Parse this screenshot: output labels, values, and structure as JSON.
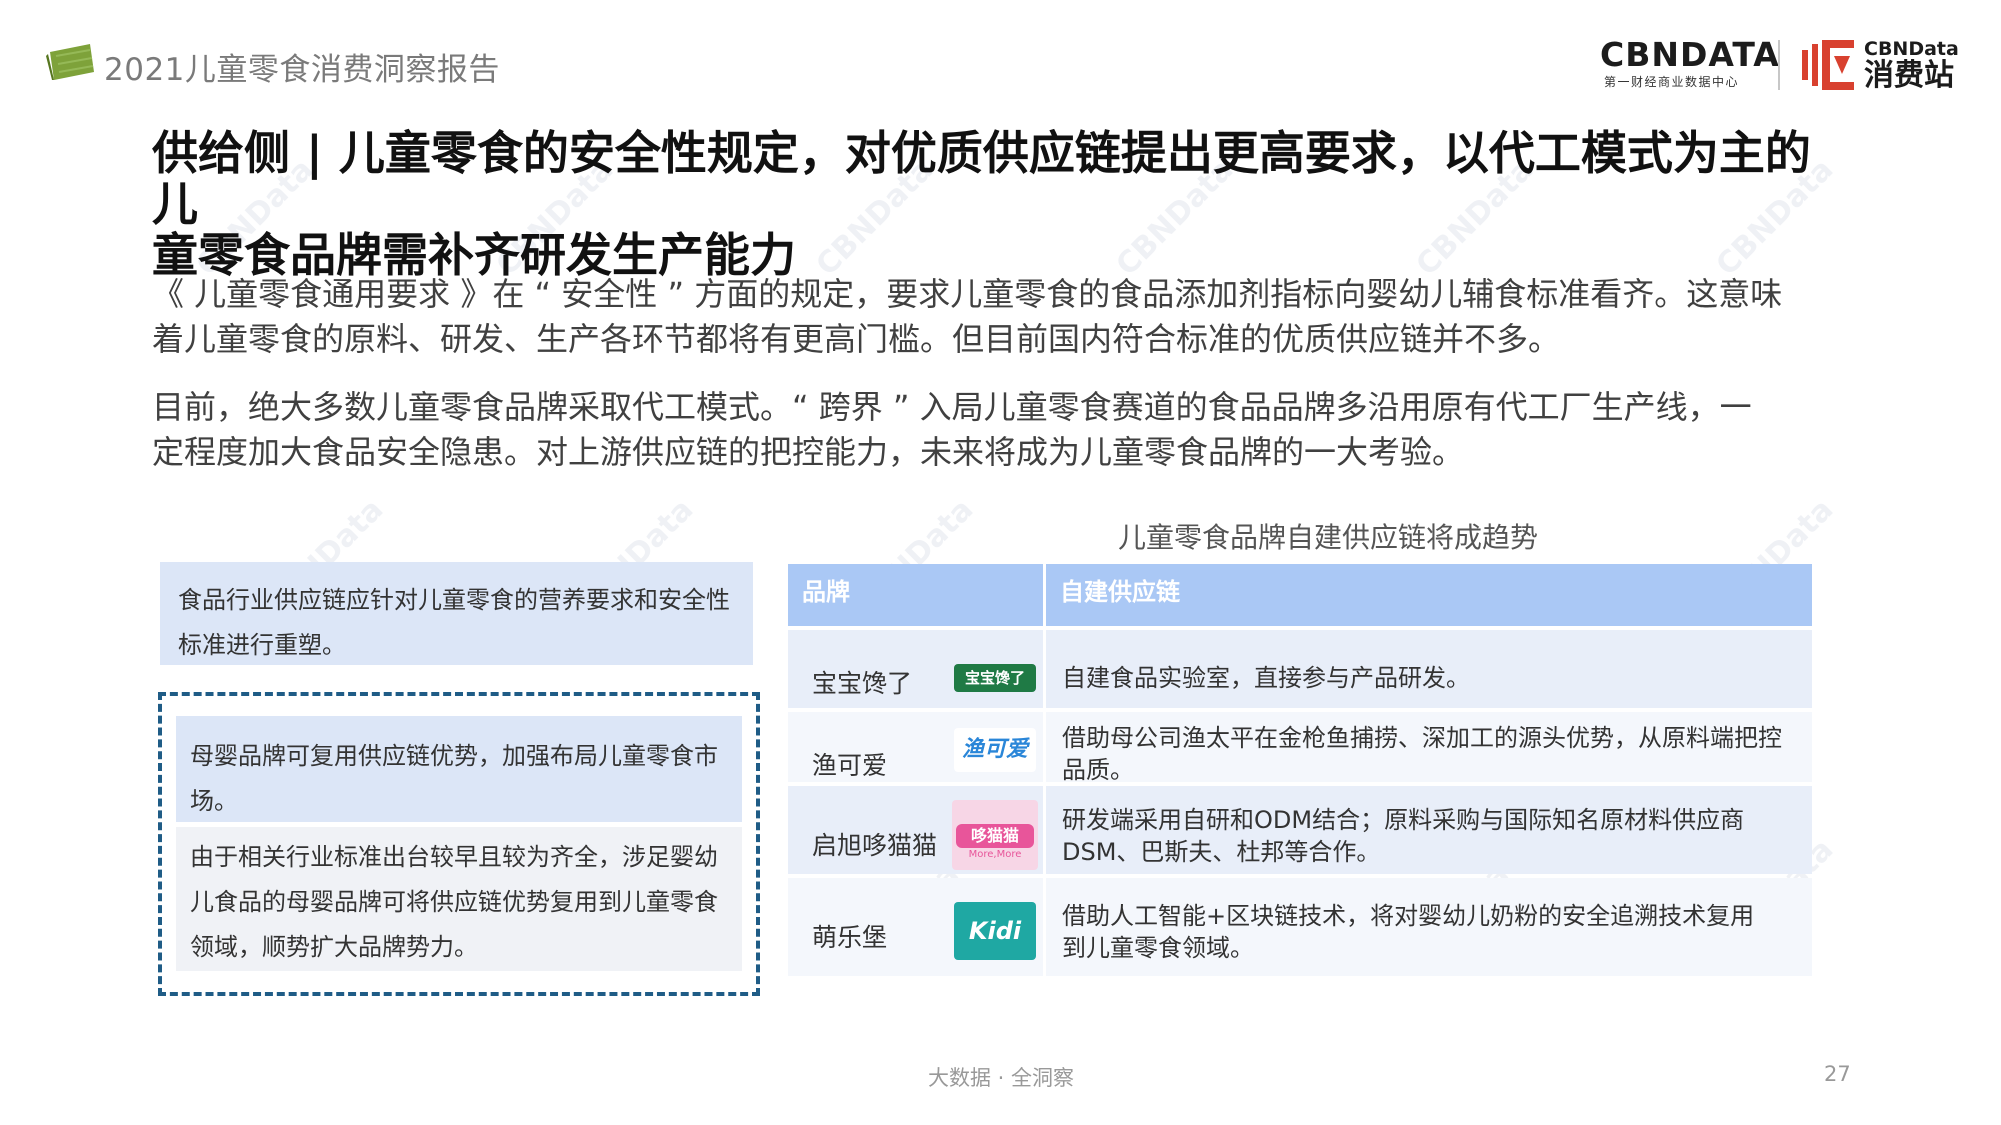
{
  "header": {
    "report_title": "2021儿童零食消费洞察报告",
    "cbndata_logo": "CBNDATA",
    "cbndata_sub": "第一财经商业数据中心",
    "xiaofeizhan_en": "CBNData",
    "xiaofeizhan_cn": "消费站"
  },
  "headline": {
    "line1": "供给侧 | 儿童零食的安全性规定，对优质供应链提出更高要求，以代工模式为主的儿",
    "line2": "童零食品牌需补齐研发生产能力"
  },
  "paragraphs": {
    "p1_line1": "《 儿童零食通用要求 》在 “ 安全性 ” 方面的规定，要求儿童零食的食品添加剂指标向婴幼儿辅食标准看齐。这意味",
    "p1_line2": "着儿童零食的原料、研发、生产各环节都将有更高门槛。但目前国内符合标准的优质供应链并不多。",
    "p2_line1": "目前，绝大多数儿童零食品牌采取代工模式。“ 跨界 ” 入局儿童零食赛道的食品品牌多沿用原有代工厂生产线，一",
    "p2_line2": "定程度加大食品安全隐患。对上游供应链的把控能力，未来将成为儿童零食品牌的一大考验。"
  },
  "left_panel": {
    "box1": "食品行业供应链应针对儿童零食的营养要求和安全性标准进行重塑。",
    "box2": "母婴品牌可复用供应链优势，加强布局儿童零食市场。",
    "box3": "由于相关行业标准出台较早且较为齐全，涉足婴幼儿食品的母婴品牌可将供应链优势复用到儿童零食领域，顺势扩大品牌势力。"
  },
  "table": {
    "title": "儿童零食品牌自建供应链将成趋势",
    "headers": {
      "brand": "品牌",
      "chain": "自建供应链"
    },
    "rows": [
      {
        "brand": "宝宝馋了",
        "logo_text": "宝宝馋了",
        "logo_color": "#1f7a45",
        "desc": "自建食品实验室，直接参与产品研发。"
      },
      {
        "brand": "渔可爱",
        "logo_text": "渔可爱",
        "logo_color": "#2a86d8",
        "desc": "借助母公司渔太平在金枪鱼捕捞、深加工的源头优势，从原料端把控品质。"
      },
      {
        "brand": "启旭哆猫猫",
        "logo_text": "哆猫猫",
        "logo_sub": "More,More",
        "logo_color": "#e8559a",
        "desc_line1": "研发端采用自研和ODM结合；原料采购与国际知名原材料供应商",
        "desc_line2": "DSM、巴斯夫、杜邦等合作。"
      },
      {
        "brand": "萌乐堡",
        "logo_text": "Kidi",
        "logo_color": "#1fa8a3",
        "desc_line1": "借助人工智能+区块链技术，将对婴幼儿奶粉的安全追溯技术复用",
        "desc_line2": "到儿童零食领域。"
      }
    ]
  },
  "footer": {
    "tagline": "大数据 · 全洞察",
    "page_number": "27"
  },
  "colors": {
    "header_blue": "#aac8f5",
    "cell_blue": "#e8eef9",
    "box_blue": "#dce6f7",
    "dash_border": "#1f5c86",
    "brand_red": "#d8412f"
  }
}
